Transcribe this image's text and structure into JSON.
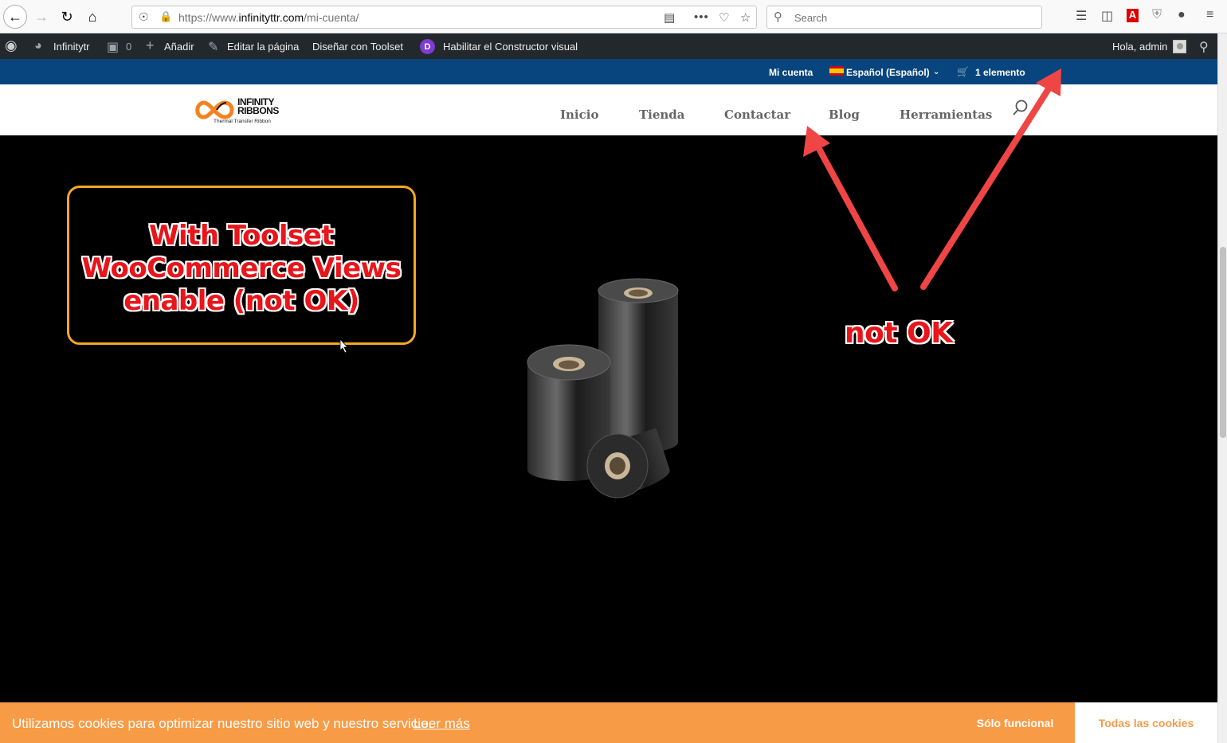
{
  "browser": {
    "url_prefix": "https://www.",
    "url_domain": "infinityttr.com",
    "url_path": "/mi-cuenta/",
    "search_placeholder": "Search"
  },
  "wp_admin": {
    "site_name": "Infinitytr",
    "comments_count": "0",
    "add_label": "Añadir",
    "edit_label": "Editar la página",
    "toolset_label": "Diseñar con Toolset",
    "divi_badge": "D",
    "builder_label": "Habilitar el Constructor visual",
    "greeting": "Hola, admin"
  },
  "top_bar": {
    "account": "Mi cuenta",
    "language": "Español (Español)",
    "cart": "1 elemento"
  },
  "header": {
    "logo_line1": "INFINITY",
    "logo_line2": "RIBBONS",
    "logo_tagline": "Thermal Transfer Ribbon",
    "menu": [
      "Inicio",
      "Tienda",
      "Contactar",
      "Blog",
      "Herramientas"
    ]
  },
  "annotation": {
    "line1": "With Toolset",
    "line2": "WooCommerce Views",
    "line3": "enable (not OK)",
    "arrow_label": "not OK"
  },
  "cookie": {
    "message": "Utilizamos cookies para optimizar nuestro sitio web y nuestro servicio.",
    "link": "Leer más",
    "btn_functional": "Sólo funcional",
    "btn_all": "Todas las cookies"
  },
  "colors": {
    "wp_bar": "#23282d",
    "top_bar": "#08457e",
    "cookie_bar": "#f89b47",
    "annotation_red": "#e8151b",
    "annotation_border": "#f5a623",
    "logo_orange": "#f58220"
  }
}
